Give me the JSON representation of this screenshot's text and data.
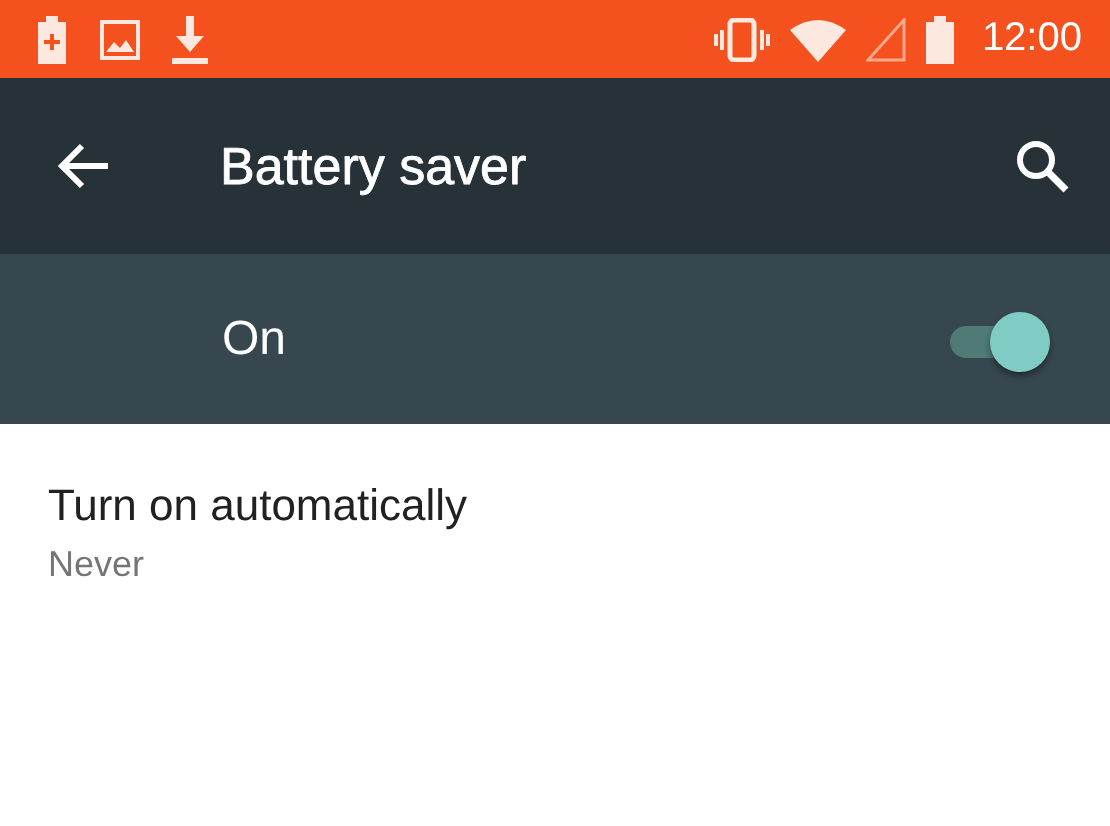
{
  "status_bar": {
    "time": "12:00"
  },
  "toolbar": {
    "title": "Battery saver"
  },
  "master_switch": {
    "label": "On",
    "on": true
  },
  "preferences": [
    {
      "title": "Turn on automatically",
      "summary": "Never"
    }
  ]
}
